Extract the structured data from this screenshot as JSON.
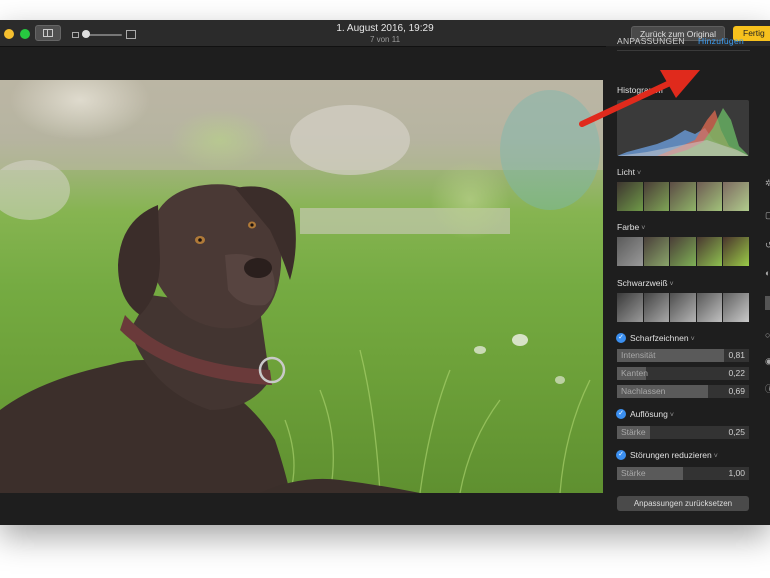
{
  "window": {
    "title": "1. August 2016, 19:29",
    "subtitle": "7 von 11",
    "revert_label": "Zurück zum Original",
    "done_label": "Fertig"
  },
  "panel": {
    "tabs": [
      "ANPASSUNGEN",
      "Hinzufügen"
    ],
    "histogram_label": "Histogramm",
    "sections": {
      "light": "Licht",
      "color": "Farbe",
      "bw": "Schwarzweiß"
    },
    "sharpen": {
      "label": "Scharfzeichnen",
      "sliders": [
        {
          "name": "Intensität",
          "value": "0,81",
          "fraction": 0.81
        },
        {
          "name": "Kanten",
          "value": "0,22",
          "fraction": 0.22
        },
        {
          "name": "Nachlassen",
          "value": "0,69",
          "fraction": 0.69
        }
      ]
    },
    "definition": {
      "label": "Auflösung",
      "sliders": [
        {
          "name": "Stärke",
          "value": "0,25",
          "fraction": 0.25
        }
      ]
    },
    "noise": {
      "label": "Störungen reduzieren",
      "sliders": [
        {
          "name": "Stärke",
          "value": "1,00",
          "fraction": 0.5
        }
      ]
    },
    "reset_label": "Anpassungen zurücksetzen"
  },
  "colors": {
    "accent_blue": "#3b9cf0",
    "done_yellow": "#f7c11d",
    "arrow_red": "#e02a1c"
  },
  "icons": [
    "sidebar-toggle-icon",
    "zoom-small-icon",
    "zoom-large-icon",
    "check-icon",
    "chevron-down-icon",
    "annotation-arrow-icon"
  ]
}
